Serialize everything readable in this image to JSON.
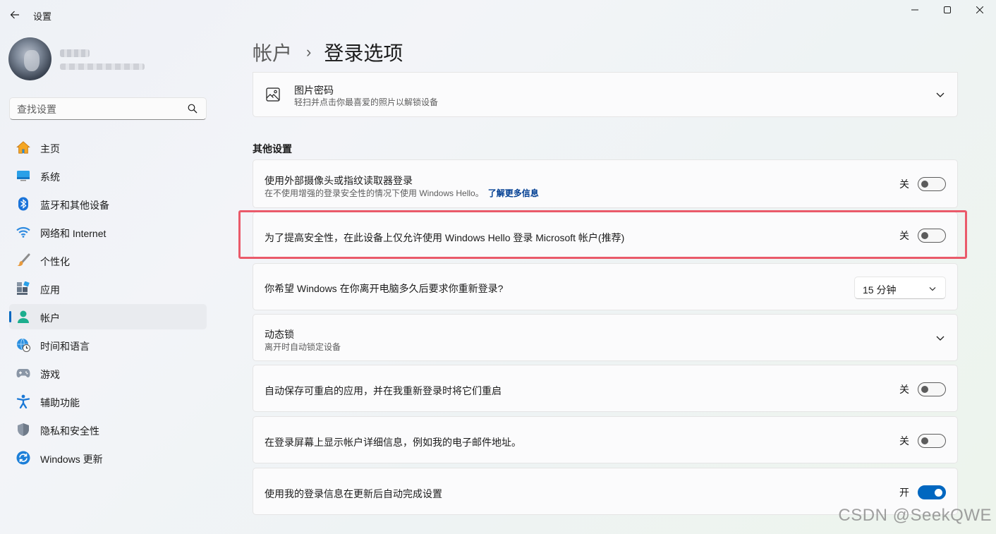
{
  "window": {
    "title": "设置",
    "back_icon": "back-arrow-icon",
    "controls": [
      "minimize-icon",
      "maximize-icon",
      "close-icon"
    ]
  },
  "sidebar": {
    "search_placeholder": "查找设置",
    "items": [
      {
        "label": "主页",
        "icon": "home-icon"
      },
      {
        "label": "系统",
        "icon": "system-icon"
      },
      {
        "label": "蓝牙和其他设备",
        "icon": "bluetooth-icon"
      },
      {
        "label": "网络和 Internet",
        "icon": "wifi-icon"
      },
      {
        "label": "个性化",
        "icon": "brush-icon"
      },
      {
        "label": "应用",
        "icon": "apps-icon"
      },
      {
        "label": "帐户",
        "icon": "account-icon",
        "selected": true
      },
      {
        "label": "时间和语言",
        "icon": "globe-clock-icon"
      },
      {
        "label": "游戏",
        "icon": "gamepad-icon"
      },
      {
        "label": "辅助功能",
        "icon": "accessibility-icon"
      },
      {
        "label": "隐私和安全性",
        "icon": "shield-icon"
      },
      {
        "label": "Windows 更新",
        "icon": "update-icon"
      }
    ]
  },
  "breadcrumb": {
    "parent": "帐户",
    "separator": "›",
    "current": "登录选项"
  },
  "picture_password": {
    "title": "图片密码",
    "subtitle": "轻扫并点击你最喜爱的照片以解锁设备",
    "icon": "picture-icon"
  },
  "other_settings": {
    "heading": "其他设置",
    "external_camera": {
      "title": "使用外部摄像头或指纹读取器登录",
      "subtitle": "在不使用增强的登录安全性的情况下使用 Windows Hello。",
      "link": "了解更多信息",
      "state_label": "关",
      "on": false
    },
    "hello_only": {
      "title": "为了提高安全性，在此设备上仅允许使用 Windows Hello 登录 Microsoft 帐户(推荐)",
      "state_label": "关",
      "on": false
    },
    "require_signin": {
      "title": "你希望 Windows 在你离开电脑多久后要求你重新登录?",
      "selected": "15 分钟"
    },
    "dynamic_lock": {
      "title": "动态锁",
      "subtitle": "离开时自动锁定设备"
    },
    "restart_apps": {
      "title": "自动保存可重启的应用，并在我重新登录时将它们重启",
      "state_label": "关",
      "on": false
    },
    "show_details": {
      "title": "在登录屏幕上显示帐户详细信息，例如我的电子邮件地址。",
      "state_label": "关",
      "on": false
    },
    "auto_finish": {
      "title": "使用我的登录信息在更新后自动完成设置",
      "state_label": "开",
      "on": true
    }
  },
  "colors": {
    "accent": "#0067c0",
    "highlight_box": "#ea5a6a"
  },
  "watermark": "CSDN @SeekQWE"
}
